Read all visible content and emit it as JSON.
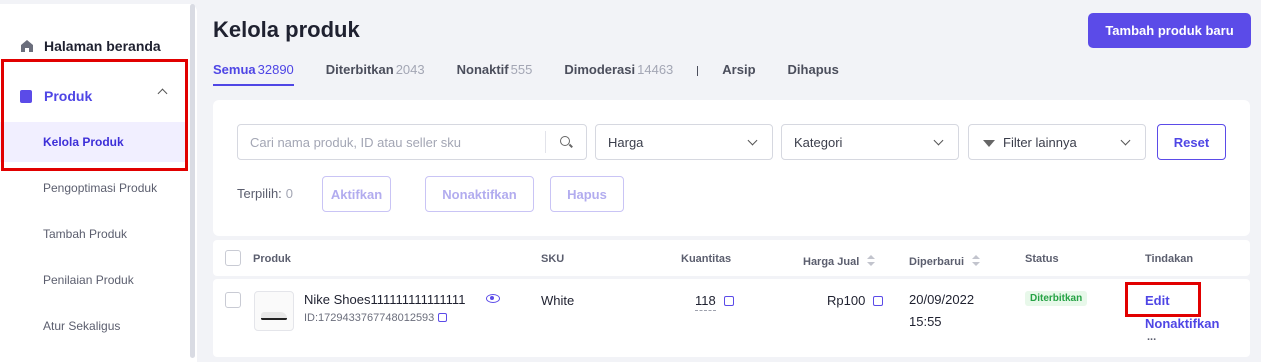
{
  "sidebar": {
    "home": "Halaman beranda",
    "produk": "Produk",
    "items": [
      "Kelola Produk",
      "Pengoptimasi Produk",
      "Tambah Produk",
      "Penilaian Produk",
      "Atur Sekaligus"
    ]
  },
  "header": {
    "title": "Kelola produk",
    "add_button": "Tambah produk baru"
  },
  "tabs": [
    {
      "label": "Semua",
      "count": "32890"
    },
    {
      "label": "Diterbitkan",
      "count": "2043"
    },
    {
      "label": "Nonaktif",
      "count": "555"
    },
    {
      "label": "Dimoderasi",
      "count": "14463"
    },
    {
      "label": "Arsip",
      "count": ""
    },
    {
      "label": "Dihapus",
      "count": ""
    }
  ],
  "filters": {
    "search_placeholder": "Cari nama produk, ID atau seller sku",
    "harga": "Harga",
    "kategori": "Kategori",
    "filter_lainnya": "Filter lainnya",
    "reset": "Reset"
  },
  "bulk": {
    "terpilih_label": "Terpilih:",
    "terpilih_count": "0",
    "aktifkan": "Aktifkan",
    "nonaktifkan": "Nonaktifkan",
    "hapus": "Hapus"
  },
  "table": {
    "headers": {
      "produk": "Produk",
      "sku": "SKU",
      "kuantitas": "Kuantitas",
      "harga": "Harga Jual",
      "diperbarui": "Diperbarui",
      "status": "Status",
      "tindakan": "Tindakan"
    },
    "rows": [
      {
        "name": "Nike Shoes111111111111111",
        "id": "ID:1729433767748012593",
        "sku": "White",
        "qty": "118",
        "price": "Rp100",
        "date": "20/09/2022",
        "time": "15:55",
        "status": "Diterbitkan",
        "action_edit": "Edit",
        "action_deactivate": "Nonaktifkan",
        "action_more": "..."
      }
    ]
  },
  "colors": {
    "accent": "#5b4be8",
    "highlight": "#e10000",
    "status_green": "#25a244"
  }
}
